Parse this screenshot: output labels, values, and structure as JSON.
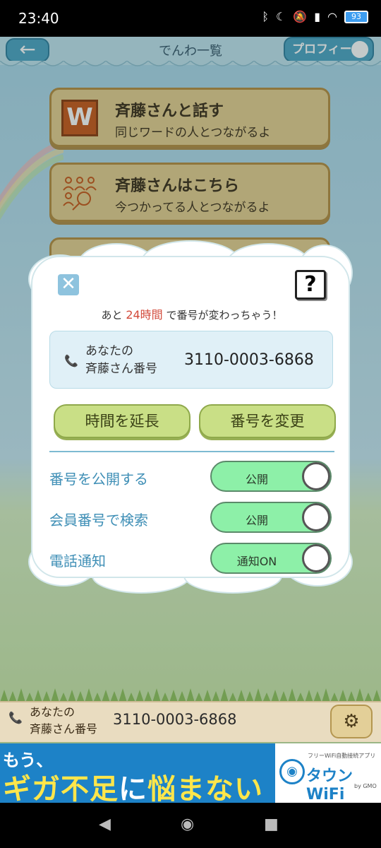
{
  "status_bar": {
    "time": "23:40",
    "battery": "93"
  },
  "header": {
    "back_label": "←",
    "title": "でんわ一覧",
    "profile_label": "プロフィール"
  },
  "menu": [
    {
      "icon_text": "W",
      "title": "斉藤さんと話す",
      "subtitle": "同じワードの人とつながるよ"
    },
    {
      "title": "斉藤さんはこちら",
      "subtitle": "今つかってる人とつながるよ"
    }
  ],
  "modal": {
    "close_label": "✕",
    "help_label": "?",
    "countdown_prefix": "あと",
    "countdown_value": "24時間",
    "countdown_suffix": "で番号が変わっちゃう！",
    "number_label_line1": "あなたの",
    "number_label_line2": "斉藤さん番号",
    "number": "3110-0003-6868",
    "extend_button": "時間を延長",
    "change_button": "番号を変更",
    "settings": [
      {
        "label": "番号を公開する",
        "state": "公開"
      },
      {
        "label": "会員番号で検索",
        "state": "公開"
      },
      {
        "label": "電話通知",
        "state": "通知ON"
      }
    ]
  },
  "bottom_bar": {
    "label_line1": "あなたの",
    "label_line2": "斉藤さん番号",
    "number": "3110-0003-6868"
  },
  "ad": {
    "line1": "もう、",
    "line2_a": "ギガ不足",
    "line2_b": "に",
    "line2_c": "悩まない",
    "logo_small": "フリーWiFi自動接続アプリ",
    "logo_big": "タウンWiFi",
    "logo_by": "by GMO"
  },
  "colors": {
    "accent_blue": "#4aa4c4",
    "highlight_red": "#d24a3a",
    "toggle_green": "#8df0a8"
  }
}
